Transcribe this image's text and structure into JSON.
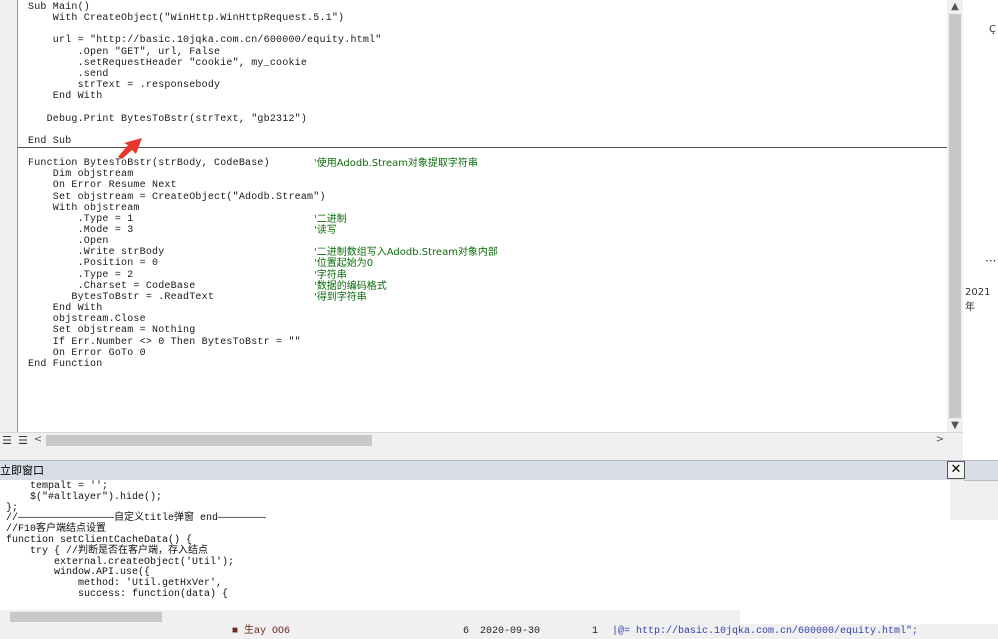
{
  "code_lines": [
    "Sub Main()",
    "    With CreateObject(\"WinHttp.WinHttpRequest.5.1\")",
    "",
    "    url = \"http://basic.10jqka.com.cn/600000/equity.html\"",
    "        .Open \"GET\", url, False",
    "        .setRequestHeader \"cookie\", my_cookie",
    "        .send",
    "        strText = .responsebody",
    "    End With",
    "",
    "   Debug.Print BytesToBstr(strText, \"gb2312\")",
    "",
    "End Sub",
    "",
    "Function BytesToBstr(strBody, CodeBase)",
    "    Dim objstream",
    "    On Error Resume Next",
    "    Set objstream = CreateObject(\"Adodb.Stream\")",
    "    With objstream",
    "        .Type = 1",
    "        .Mode = 3",
    "        .Open",
    "        .Write strBody",
    "        .Position = 0",
    "        .Type = 2",
    "        .Charset = CodeBase",
    "       BytesToBstr = .ReadText",
    "    End With",
    "    objstream.Close",
    "    Set objstream = Nothing",
    "    If Err.Number <> 0 Then BytesToBstr = \"\"",
    "    On Error GoTo 0",
    "End Function"
  ],
  "code_comments": [
    {
      "line": 14,
      "text": "'使用Adodb.Stream对象提取字符串"
    },
    {
      "line": 19,
      "text": "'二进制"
    },
    {
      "line": 20,
      "text": "'读写"
    },
    {
      "line": 22,
      "text": "'二进制数组写入Adodb.Stream对象内部"
    },
    {
      "line": 23,
      "text": "'位置起始为0"
    },
    {
      "line": 24,
      "text": "'字符串"
    },
    {
      "line": 25,
      "text": "'数据的编码格式"
    },
    {
      "line": 26,
      "text": "'得到字符串"
    }
  ],
  "right_strip": {
    "partial_char": "Ç",
    "dots": "···",
    "year_partial": "2021年"
  },
  "immediate": {
    "title": "立即窗口",
    "close_glyph": "✕",
    "lines": [
      "    tempalt = '';",
      "    $(\"#altlayer\").hide();",
      "};",
      "//————————————————自定义title弹窗 end————————",
      "//F10客户端结点设置",
      "function setClientCacheData() {",
      "    try { //判断是否在客户端，存入结点",
      "        external.createObject('Util');",
      "        window.API.use({",
      "            method: 'Util.getHxVer',",
      "            success: function(data) {"
    ]
  },
  "bottom_row": {
    "name_partial": "■ 生ay OO6",
    "count": "6",
    "date": "2020-09-30",
    "num": "1",
    "formula": "|@= http://basic.10jqka.com.cn/600000/equity.html\";"
  },
  "scroll_glyphs": {
    "up": "▲",
    "down": "▼",
    "left": "<",
    "right": ">",
    "view_toggle": "☰"
  }
}
